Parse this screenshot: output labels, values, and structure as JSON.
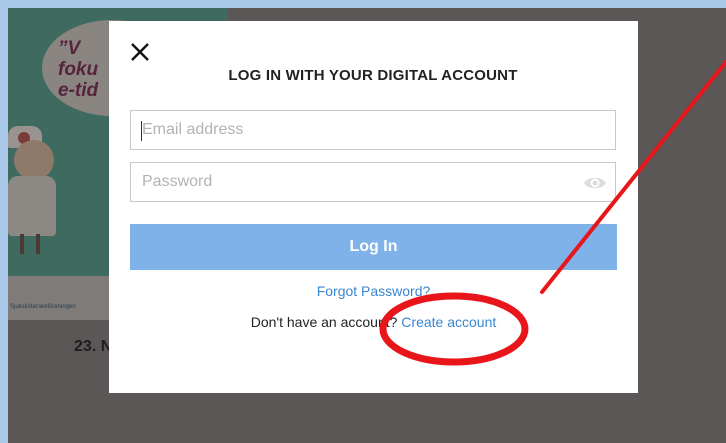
{
  "background": {
    "bubble_lines": [
      "”V",
      "foku",
      "e-tid"
    ],
    "organization": "Sjuksköterskeföreningen",
    "date_fragment": "23. N"
  },
  "modal": {
    "title": "LOG IN WITH YOUR DIGITAL ACCOUNT",
    "close_icon": "close-icon",
    "email": {
      "placeholder": "Email address",
      "value": ""
    },
    "password": {
      "placeholder": "Password",
      "value": "",
      "toggle_icon": "eye-icon"
    },
    "login_label": "Log In",
    "forgot_label": "Forgot Password?",
    "signup_prompt": "Don't have an account?",
    "signup_link": "Create account"
  },
  "colors": {
    "primary_button": "#7fb2e8",
    "link": "#3b86d0",
    "annotation": "#e8161b"
  }
}
